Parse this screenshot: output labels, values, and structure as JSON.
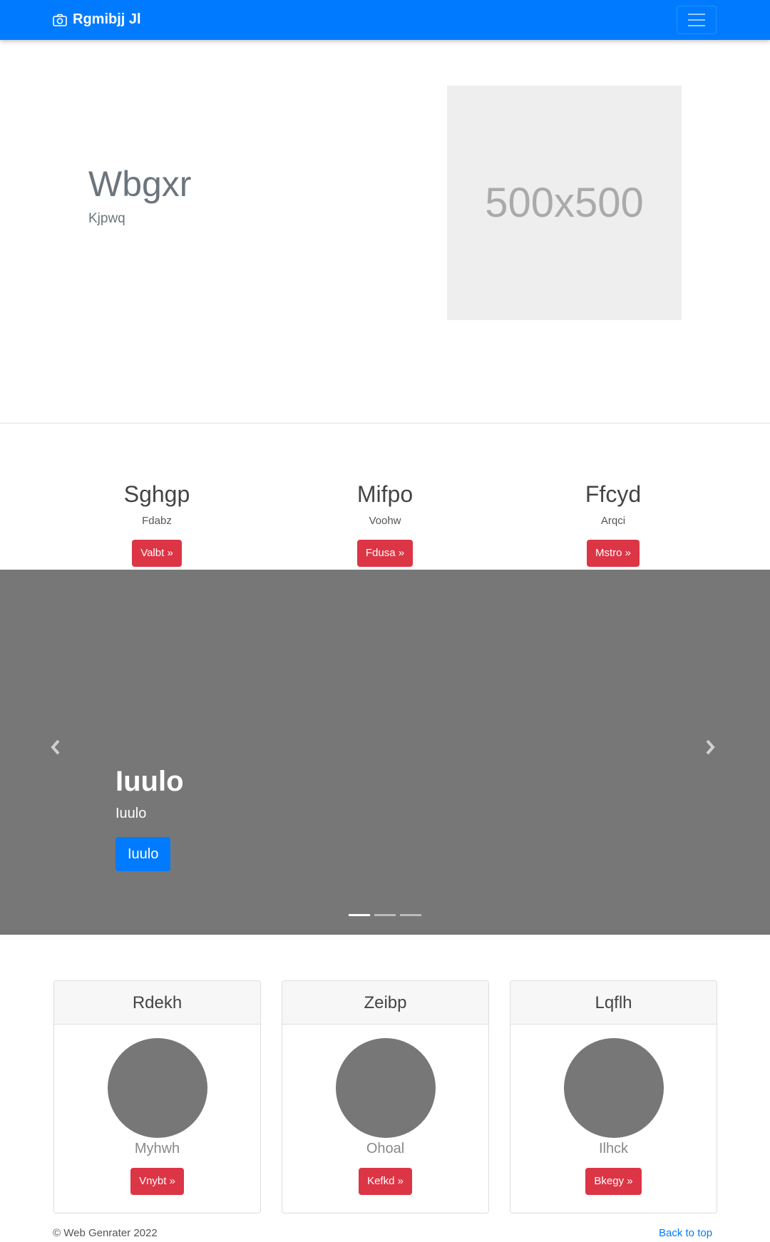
{
  "navbar": {
    "brand": "Rgmibjj Jl",
    "brand_icon": "camera-icon",
    "toggler_icon": "hamburger-menu-icon"
  },
  "hero": {
    "title": "Wbgxr",
    "subtitle": "Kjpwq",
    "image_placeholder": "500x500"
  },
  "features": [
    {
      "title": "Sghgp",
      "text": "Fdabz",
      "button": "Valbt »"
    },
    {
      "title": "Mifpo",
      "text": "Voohw",
      "button": "Fdusa »"
    },
    {
      "title": "Ffcyd",
      "text": "Arqci",
      "button": "Mstro »"
    }
  ],
  "carousel": {
    "caption_title": "Iuulo",
    "caption_text": "Iuulo",
    "caption_button": "Iuulo",
    "prev_icon": "chevron-left-icon",
    "next_icon": "chevron-right-icon",
    "slides_count": 3,
    "active_slide": 1
  },
  "cards": [
    {
      "header": "Rdekh",
      "name": "Myhwh",
      "button": "Vnybt »"
    },
    {
      "header": "Zeibp",
      "name": "Ohoal",
      "button": "Kefkd »"
    },
    {
      "header": "Lqflh",
      "name": "Ilhck",
      "button": "Bkegy »"
    }
  ],
  "footer": {
    "copyright": "© Web Genrater 2022",
    "back_to_top": "Back to top"
  },
  "colors": {
    "primary": "#007bff",
    "danger": "#dc3545",
    "carousel_bg": "#777777",
    "placeholder_bg": "#eeeeee"
  }
}
